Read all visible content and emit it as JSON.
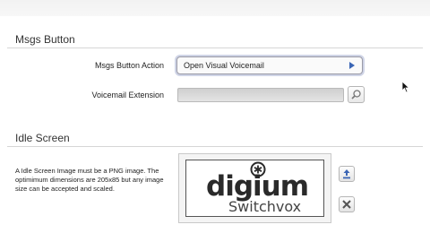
{
  "msgs": {
    "section_title": "Msgs Button",
    "action_label": "Msgs Button Action",
    "action_value": "Open Visual Voicemail",
    "extension_label": "Voicemail Extension",
    "extension_value": ""
  },
  "idle": {
    "section_title": "Idle Screen",
    "description": "A Idle Screen Image must be a PNG image. The optimimum dimensions are 205x85 but any image size can be accepted and scaled.",
    "logo_main": "digium",
    "logo_sub": "Switchvox"
  },
  "icons": {
    "dropdown": "triangle-right-icon",
    "lookup": "magnifier-icon",
    "upload": "upload-icon",
    "delete": "close-icon"
  },
  "colors": {
    "accent": "#3b66b5",
    "focus_ring": "#cfd4e6"
  }
}
